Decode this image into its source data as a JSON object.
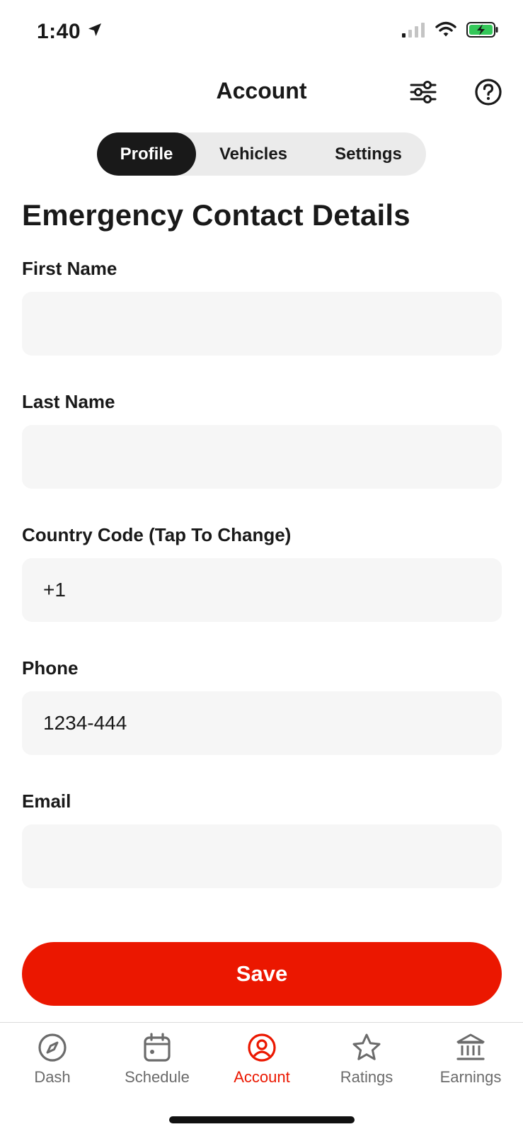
{
  "status_bar": {
    "time": "1:40"
  },
  "header": {
    "title": "Account"
  },
  "tabs": [
    {
      "label": "Profile",
      "active": true
    },
    {
      "label": "Vehicles",
      "active": false
    },
    {
      "label": "Settings",
      "active": false
    }
  ],
  "section_title": "Emergency Contact Details",
  "form": {
    "first_name": {
      "label": "First Name",
      "value": ""
    },
    "last_name": {
      "label": "Last Name",
      "value": ""
    },
    "country_code": {
      "label": "Country Code (Tap To Change)",
      "value": "+1"
    },
    "phone": {
      "label": "Phone",
      "value": "1234-444"
    },
    "email": {
      "label": "Email",
      "value": ""
    }
  },
  "save_button": {
    "label": "Save"
  },
  "bottom_nav": {
    "items": [
      {
        "label": "Dash",
        "icon": "compass-icon",
        "active": false
      },
      {
        "label": "Schedule",
        "icon": "calendar-icon",
        "active": false
      },
      {
        "label": "Account",
        "icon": "account-icon",
        "active": true
      },
      {
        "label": "Ratings",
        "icon": "star-icon",
        "active": false
      },
      {
        "label": "Earnings",
        "icon": "bank-icon",
        "active": false
      }
    ]
  },
  "colors": {
    "accent": "#eb1700",
    "dark": "#191919",
    "input_bg": "#f6f6f6",
    "battery_green": "#34c759"
  }
}
